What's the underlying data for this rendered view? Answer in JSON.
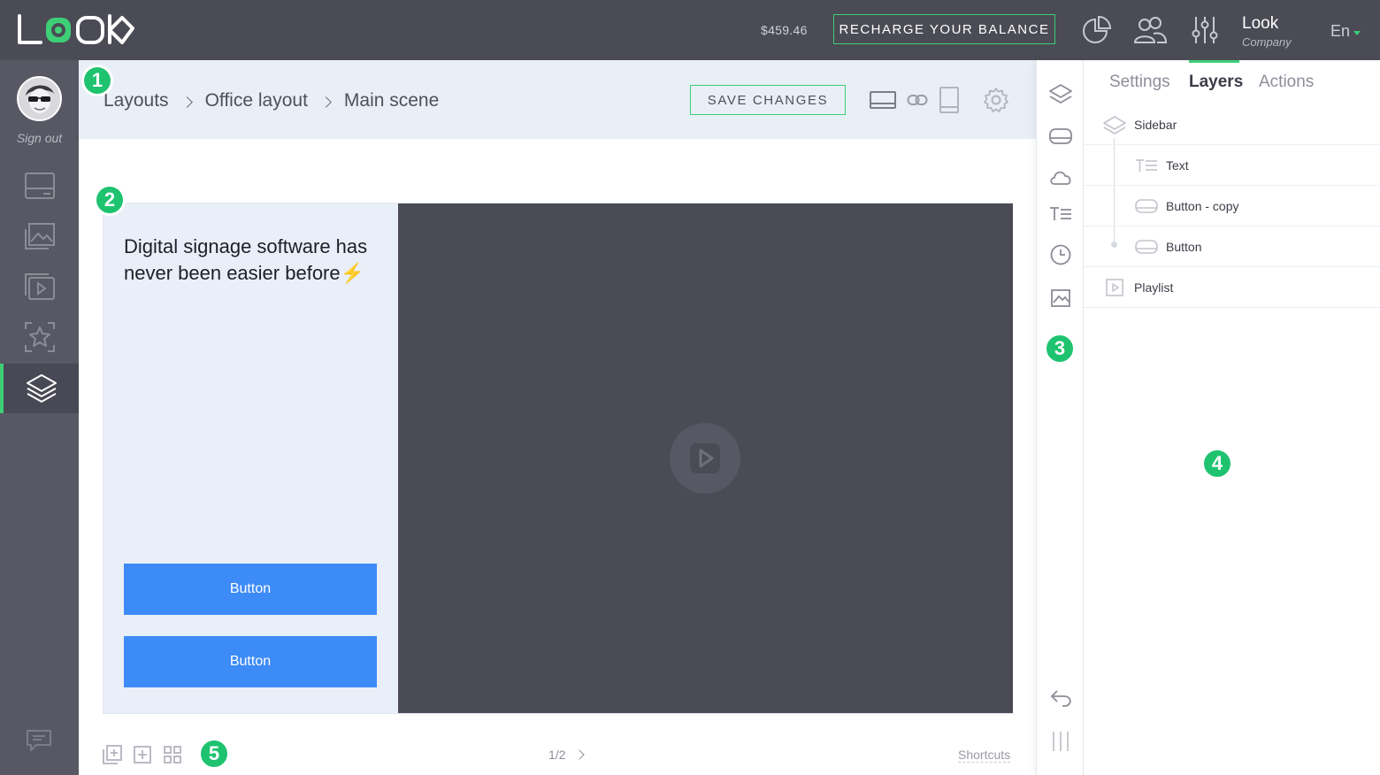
{
  "topbar": {
    "logo_text": "LOOK",
    "balance": "$459.46",
    "recharge_label": "RECHARGE YOUR BALANCE",
    "icons": [
      "analytics-pie-icon",
      "users-icon",
      "sliders-icon"
    ],
    "user_name": "Look",
    "user_company": "Company",
    "language": "En"
  },
  "leftnav": {
    "signout_label": "Sign out",
    "items": [
      {
        "icon": "screen-icon",
        "active": false
      },
      {
        "icon": "image-gallery-icon",
        "active": false
      },
      {
        "icon": "playlist-icon",
        "active": false
      },
      {
        "icon": "star-frame-icon",
        "active": false
      },
      {
        "icon": "layers-icon",
        "active": true
      }
    ],
    "chat_icon": "chat-icon"
  },
  "header": {
    "breadcrumbs": [
      "Layouts",
      "Office layout",
      "Main scene"
    ],
    "save_label": "SAVE CHANGES",
    "icons": [
      "landscape-icon",
      "link-icon",
      "portrait-icon",
      "settings-gear-icon"
    ]
  },
  "scene": {
    "headline": "Digital signage software has never been easier before",
    "headline_emoji": "⚡",
    "buttons": [
      "Button",
      "Button"
    ]
  },
  "bottombar": {
    "icons": [
      "add-layer-icon",
      "add-frame-icon",
      "grid-icon"
    ],
    "pager": "1/2",
    "shortcuts_label": "Shortcuts"
  },
  "tools": [
    "layers-icon",
    "button-shape-icon",
    "cloud-icon",
    "text-icon",
    "clock-icon",
    "image-icon",
    "undo-icon",
    "drag-handle-icon"
  ],
  "right_panel": {
    "tabs": [
      {
        "label": "Settings",
        "active": false
      },
      {
        "label": "Layers",
        "active": true
      },
      {
        "label": "Actions",
        "active": false
      }
    ],
    "layers": [
      {
        "label": "Sidebar",
        "icon": "layers-icon",
        "indent": 0
      },
      {
        "label": "Text",
        "icon": "text-icon",
        "indent": 1
      },
      {
        "label": "Button - copy",
        "icon": "button-shape-icon",
        "indent": 1
      },
      {
        "label": "Button",
        "icon": "button-shape-icon",
        "indent": 1
      },
      {
        "label": "Playlist",
        "icon": "playlist-icon",
        "indent": 0
      }
    ]
  },
  "markers": [
    "1",
    "2",
    "3",
    "4",
    "5"
  ],
  "colors": {
    "accent": "#3ecf76",
    "marker": "#1fc36f",
    "topbar": "#4a4b55",
    "leftnav": "#575864",
    "scene_button": "#3d8bf7",
    "video_bg": "#4a4b55",
    "header_bg": "#e9eff6"
  }
}
